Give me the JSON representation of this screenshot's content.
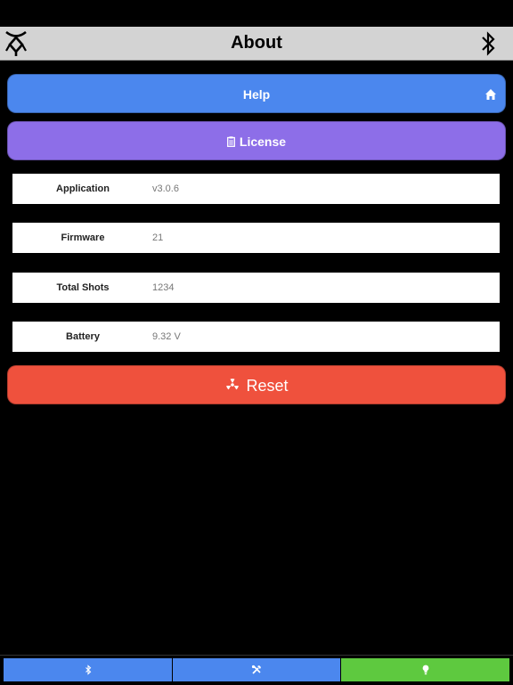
{
  "header": {
    "title": "About",
    "logo_icon": "angelic-rune-icon",
    "bluetooth_icon": "bluetooth-icon"
  },
  "buttons": {
    "help_label": "Help",
    "license_label": "License",
    "reset_label": "Reset"
  },
  "info_rows": [
    {
      "label": "Application",
      "value": "v3.0.6"
    },
    {
      "label": "Firmware",
      "value": "21"
    },
    {
      "label": "Total Shots",
      "value": "1234"
    },
    {
      "label": "Battery",
      "value": "9.32 V"
    }
  ],
  "tabs": [
    {
      "icon": "bluetooth-icon",
      "color": "#4b87ee"
    },
    {
      "icon": "tools-icon",
      "color": "#4b87ee"
    },
    {
      "icon": "lightbulb-icon",
      "color": "#5ec93f",
      "selected": true
    }
  ],
  "colors": {
    "help": "#4b87ee",
    "license": "#8d6ee8",
    "reset": "#ef513d",
    "header": "#d3d3d3"
  }
}
